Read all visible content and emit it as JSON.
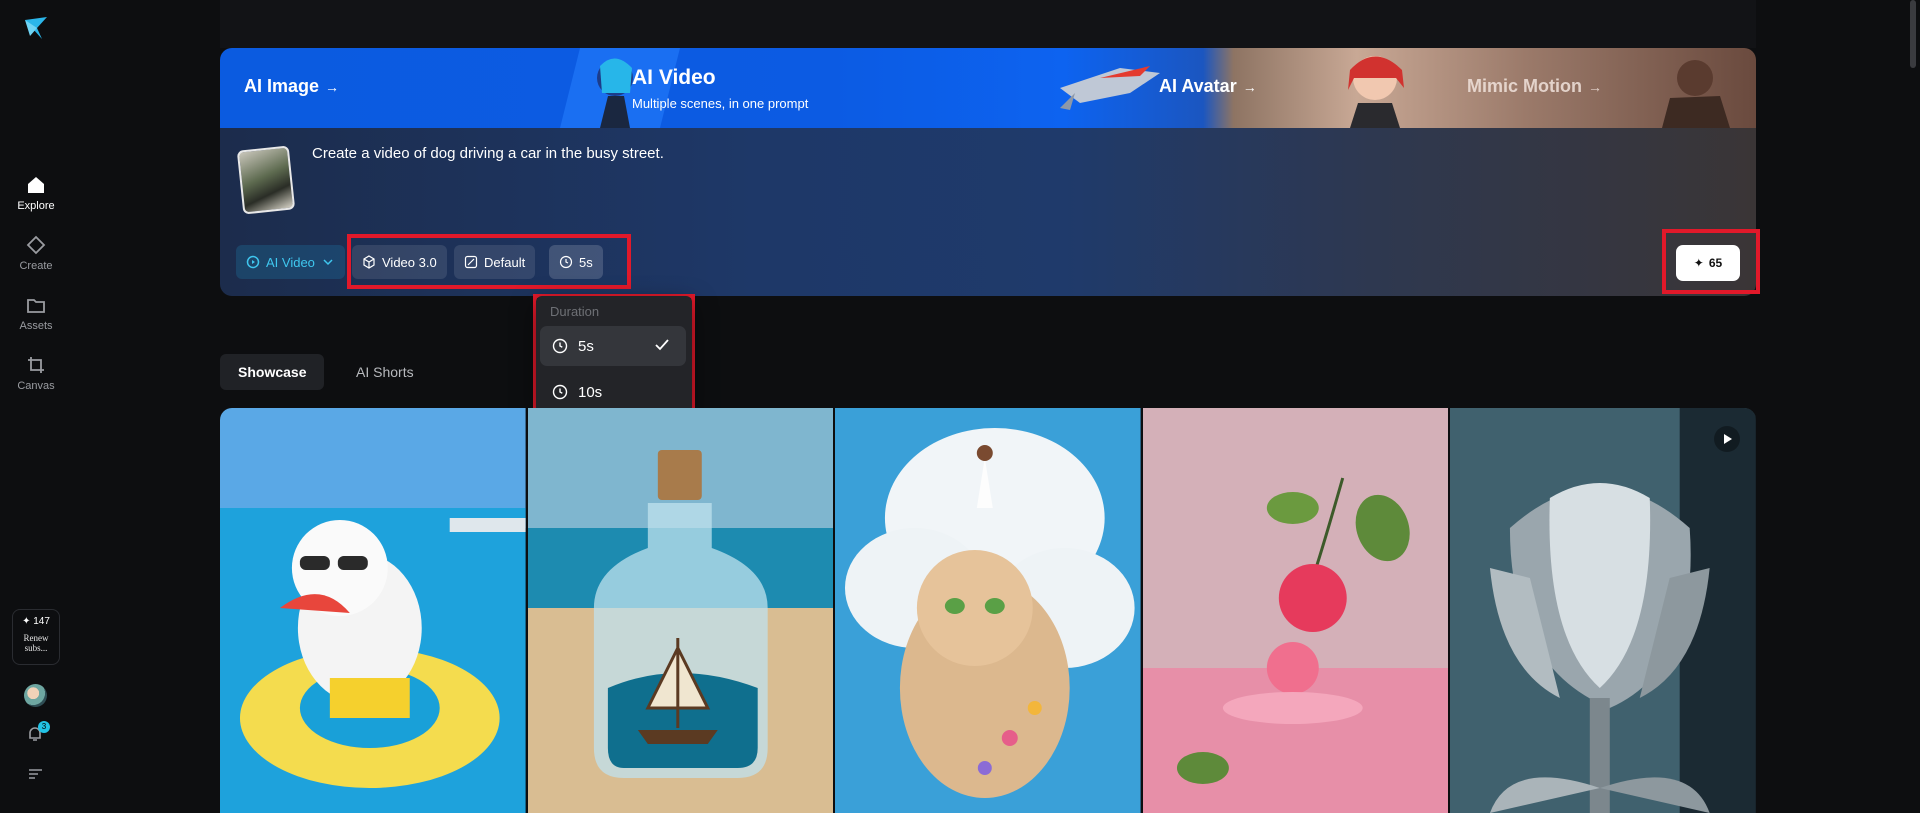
{
  "sidebar": {
    "items": [
      {
        "label": "Explore",
        "icon": "home-icon",
        "active": true
      },
      {
        "label": "Create",
        "icon": "diamond-icon",
        "active": false
      },
      {
        "label": "Assets",
        "icon": "folder-icon",
        "active": false
      },
      {
        "label": "Canvas",
        "icon": "crop-icon",
        "active": false
      }
    ],
    "credits": "✦ 147",
    "renew": "Renew subs...",
    "notification_count": "3"
  },
  "banner": {
    "tabs": [
      {
        "label": "AI Image",
        "arrow": "→"
      },
      {
        "label": "AI Video",
        "subtitle": "Multiple scenes, in one prompt"
      },
      {
        "label": "AI Avatar",
        "arrow": "→"
      },
      {
        "label": "Mimic Motion",
        "arrow": "→"
      }
    ]
  },
  "prompt": {
    "text": "Create a video of dog driving a car in the busy street.",
    "mode": "AI Video",
    "model": "Video 3.0",
    "ratio": "Default",
    "duration": "5s",
    "generate_cost": "65"
  },
  "duration_menu": {
    "header": "Duration",
    "options": [
      {
        "label": "5s",
        "selected": true
      },
      {
        "label": "10s",
        "selected": false
      }
    ]
  },
  "filters": {
    "showcase": "Showcase",
    "shorts": "AI Shorts"
  },
  "colors": {
    "accent": "#3fc7ef",
    "highlight": "#e1192a",
    "background": "#0d0e10"
  }
}
